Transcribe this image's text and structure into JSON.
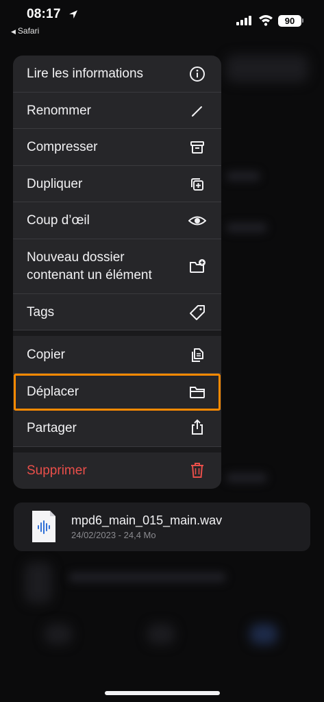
{
  "status_bar": {
    "time": "08:17",
    "back_app": "Safari",
    "battery": "90"
  },
  "menu": {
    "items": [
      {
        "label": "Lire les informations",
        "icon": "info-icon"
      },
      {
        "label": "Renommer",
        "icon": "pencil-icon"
      },
      {
        "label": "Compresser",
        "icon": "archive-box-icon"
      },
      {
        "label": "Dupliquer",
        "icon": "duplicate-icon"
      },
      {
        "label": "Coup d’œil",
        "icon": "eye-icon"
      },
      {
        "label": "Nouveau dossier contenant un élément",
        "label_line1": "Nouveau dossier",
        "label_line2": "contenant un élément",
        "icon": "folder-badge-plus-icon"
      },
      {
        "label": "Tags",
        "icon": "tag-icon"
      },
      {
        "label": "Copier",
        "icon": "copy-docs-icon"
      },
      {
        "label": "Déplacer",
        "icon": "folder-icon"
      },
      {
        "label": "Partager",
        "icon": "share-icon"
      },
      {
        "label": "Supprimer",
        "icon": "trash-icon"
      }
    ],
    "highlight_color": "#ff8a00",
    "danger_color": "#ea4f4a"
  },
  "file": {
    "name": "mpd6_main_015_main.wav",
    "meta": "24/02/2023 - 24,4 Mo",
    "icon": "audio-file-icon"
  }
}
